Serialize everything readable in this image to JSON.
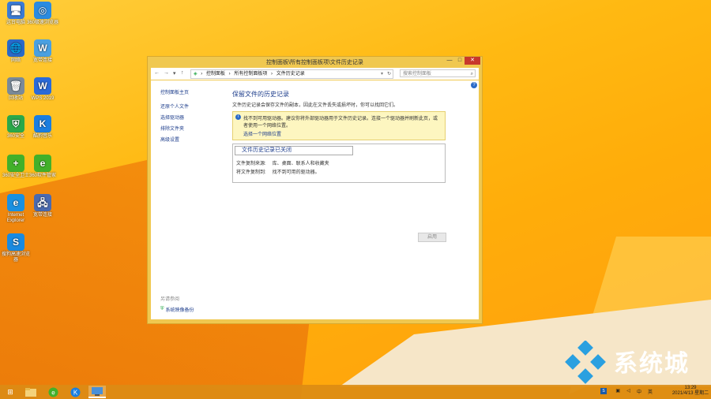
{
  "desktop": {
    "icons": [
      {
        "label": "这台电脑",
        "color": "#3a7bd5",
        "glyph": "🖥"
      },
      {
        "label": "360极速浏览器",
        "color": "#2a8be0",
        "glyph": "◎"
      },
      {
        "label": "网络",
        "color": "#2a6ac9",
        "glyph": "🌐"
      },
      {
        "label": "宽带连接",
        "color": "#4aa0e0",
        "glyph": "W"
      },
      {
        "label": "回收站",
        "color": "#7a8a99",
        "glyph": "🗑"
      },
      {
        "label": "WPS 2019",
        "color": "#2a6ad8",
        "glyph": "W"
      },
      {
        "label": "360安全",
        "color": "#2aa84a",
        "glyph": "⛨"
      },
      {
        "label": "酷狗音乐",
        "color": "#1a7ee0",
        "glyph": "K"
      },
      {
        "label": "360安全卫士",
        "color": "#42b02a",
        "glyph": "+"
      },
      {
        "label": "360软件管家",
        "color": "#42b02a",
        "glyph": "e"
      },
      {
        "label": "Internet Explorer",
        "color": "#1a90e0",
        "glyph": "e"
      },
      {
        "label": "宽带连接",
        "color": "#4a6ab0",
        "glyph": "🖧"
      },
      {
        "label": "搜狗高速浏览器",
        "color": "#1a8ae0",
        "glyph": "S"
      }
    ]
  },
  "window": {
    "title": "控制面板\\所有控制面板项\\文件历史记录",
    "min": "—",
    "max": "□",
    "close": "✕",
    "address": {
      "back": "←",
      "forward": "→",
      "down": "▾",
      "up": "↑",
      "crumbs": [
        "控制面板",
        "所有控制面板项",
        "文件历史记录"
      ],
      "sep": "›",
      "refresh": "↻"
    },
    "search_placeholder": "搜索控制面板",
    "search_icon": "⌕",
    "help": "?",
    "left_nav": {
      "home": "控制面板主页",
      "items": [
        "还原个人文件",
        "选择驱动器",
        "排除文件夹",
        "高级设置"
      ]
    },
    "see_also": {
      "title": "另请参阅",
      "link": "系统映像备份"
    },
    "main": {
      "heading": "保留文件的历史记录",
      "description": "文件历史记录会保存文件的副本，因此在文件丢失或损坏时，你可以找回它们。",
      "info_text": "找不到可用驱动器。建议你将外部驱动器用于文件历史记录。连接一个驱动器并刷新此页，或者使用一个网络位置。",
      "info_link": "选择一个网络位置",
      "status_header": "文件历史记录已关闭",
      "row1_label": "文件复制来源:",
      "row1_value": "库、桌面、联系人和收藏夹",
      "row2_label": "将文件复制到:",
      "row2_value": "找不到可用的驱动器。",
      "apply": "启用"
    }
  },
  "taskbar": {
    "start": "⊞",
    "tray_text": "中",
    "ime": "英",
    "time": "13:29",
    "date": "2021/4/13 星期二"
  },
  "watermark": {
    "text": "系统城"
  }
}
